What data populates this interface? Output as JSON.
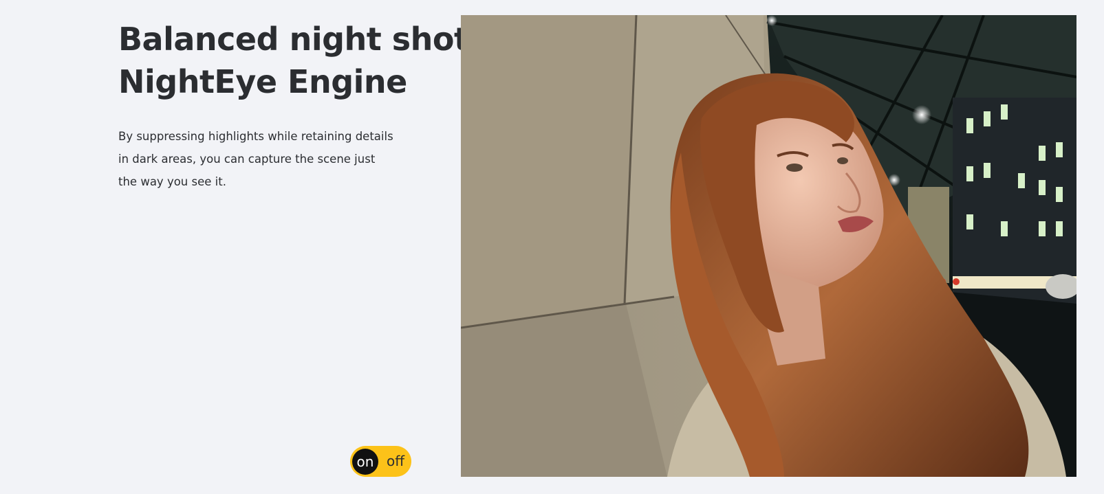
{
  "headline": {
    "line1": "Balanced night shots.",
    "line2": "NightEye Engine"
  },
  "description": "By suppressing highlights while retaining details in dark areas, you can capture the scene just the way you see it.",
  "toggle": {
    "on_label": "on",
    "off_label": "off",
    "state": "on"
  },
  "colors": {
    "background": "#f2f3f7",
    "accent": "#fcc219",
    "text": "#2b2d31"
  }
}
